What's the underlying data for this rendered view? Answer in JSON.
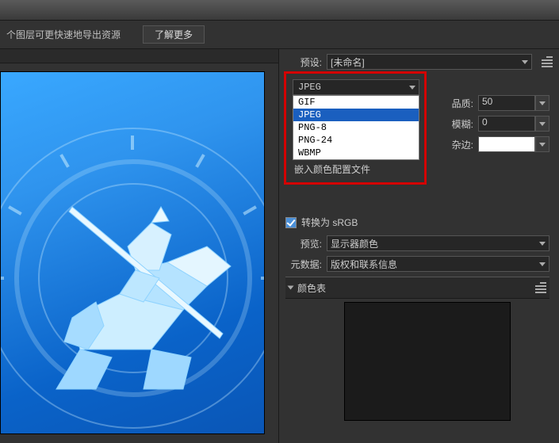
{
  "hint": {
    "text": "个图层可更快速地导出资源",
    "learn_more": "了解更多"
  },
  "preset": {
    "label": "预设:",
    "value": "[未命名]"
  },
  "format": {
    "selected": "JPEG",
    "options": [
      "GIF",
      "JPEG",
      "PNG-8",
      "PNG-24",
      "WBMP"
    ],
    "embed_profile": "嵌入颜色配置文件"
  },
  "settings": {
    "quality_label": "品质:",
    "quality_value": "50",
    "blur_label": "模糊:",
    "blur_value": "0",
    "matte_label": "杂边:",
    "matte_color": "#ffffff"
  },
  "convert": {
    "srgb_label": "转换为 sRGB",
    "srgb_checked": true,
    "preview_label": "预览:",
    "preview_value": "显示器颜色",
    "metadata_label": "元数据:",
    "metadata_value": "版权和联系信息"
  },
  "swatches": {
    "header": "颜色表"
  }
}
